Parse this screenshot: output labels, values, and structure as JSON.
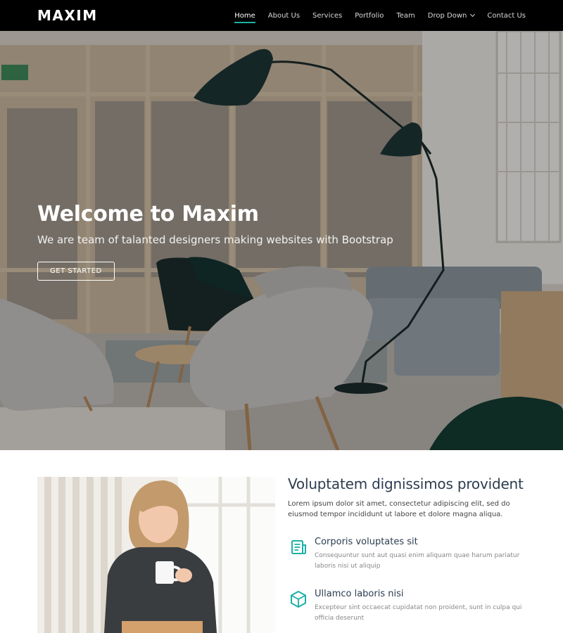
{
  "header": {
    "logo": "MAXIM",
    "nav": [
      {
        "label": "Home",
        "active": true
      },
      {
        "label": "About Us"
      },
      {
        "label": "Services"
      },
      {
        "label": "Portfolio"
      },
      {
        "label": "Team"
      },
      {
        "label": "Drop Down",
        "icon": "chevron-down-icon"
      },
      {
        "label": "Contact Us"
      }
    ]
  },
  "hero": {
    "title": "Welcome to Maxim",
    "subtitle": "We are team of talanted designers making websites with Bootstrap",
    "button": "GET STARTED"
  },
  "about": {
    "title": "Voluptatem dignissimos provident",
    "description": "Lorem ipsum dolor sit amet, consectetur adipiscing elit, sed do eiusmod tempor incididunt ut labore et dolore magna aliqua.",
    "features": [
      {
        "icon": "newspaper-icon",
        "title": "Corporis voluptates sit",
        "text": "Consequuntur sunt aut quasi enim aliquam quae harum pariatur laboris nisi ut aliquip"
      },
      {
        "icon": "cube-icon",
        "title": "Ullamco laboris nisi",
        "text": "Excepteur sint occaecat cupidatat non proident, sunt in culpa qui officia deserunt"
      }
    ]
  },
  "colors": {
    "accent": "#1bb1a5",
    "header_bg": "#000000",
    "heading": "#2b3d4f"
  }
}
